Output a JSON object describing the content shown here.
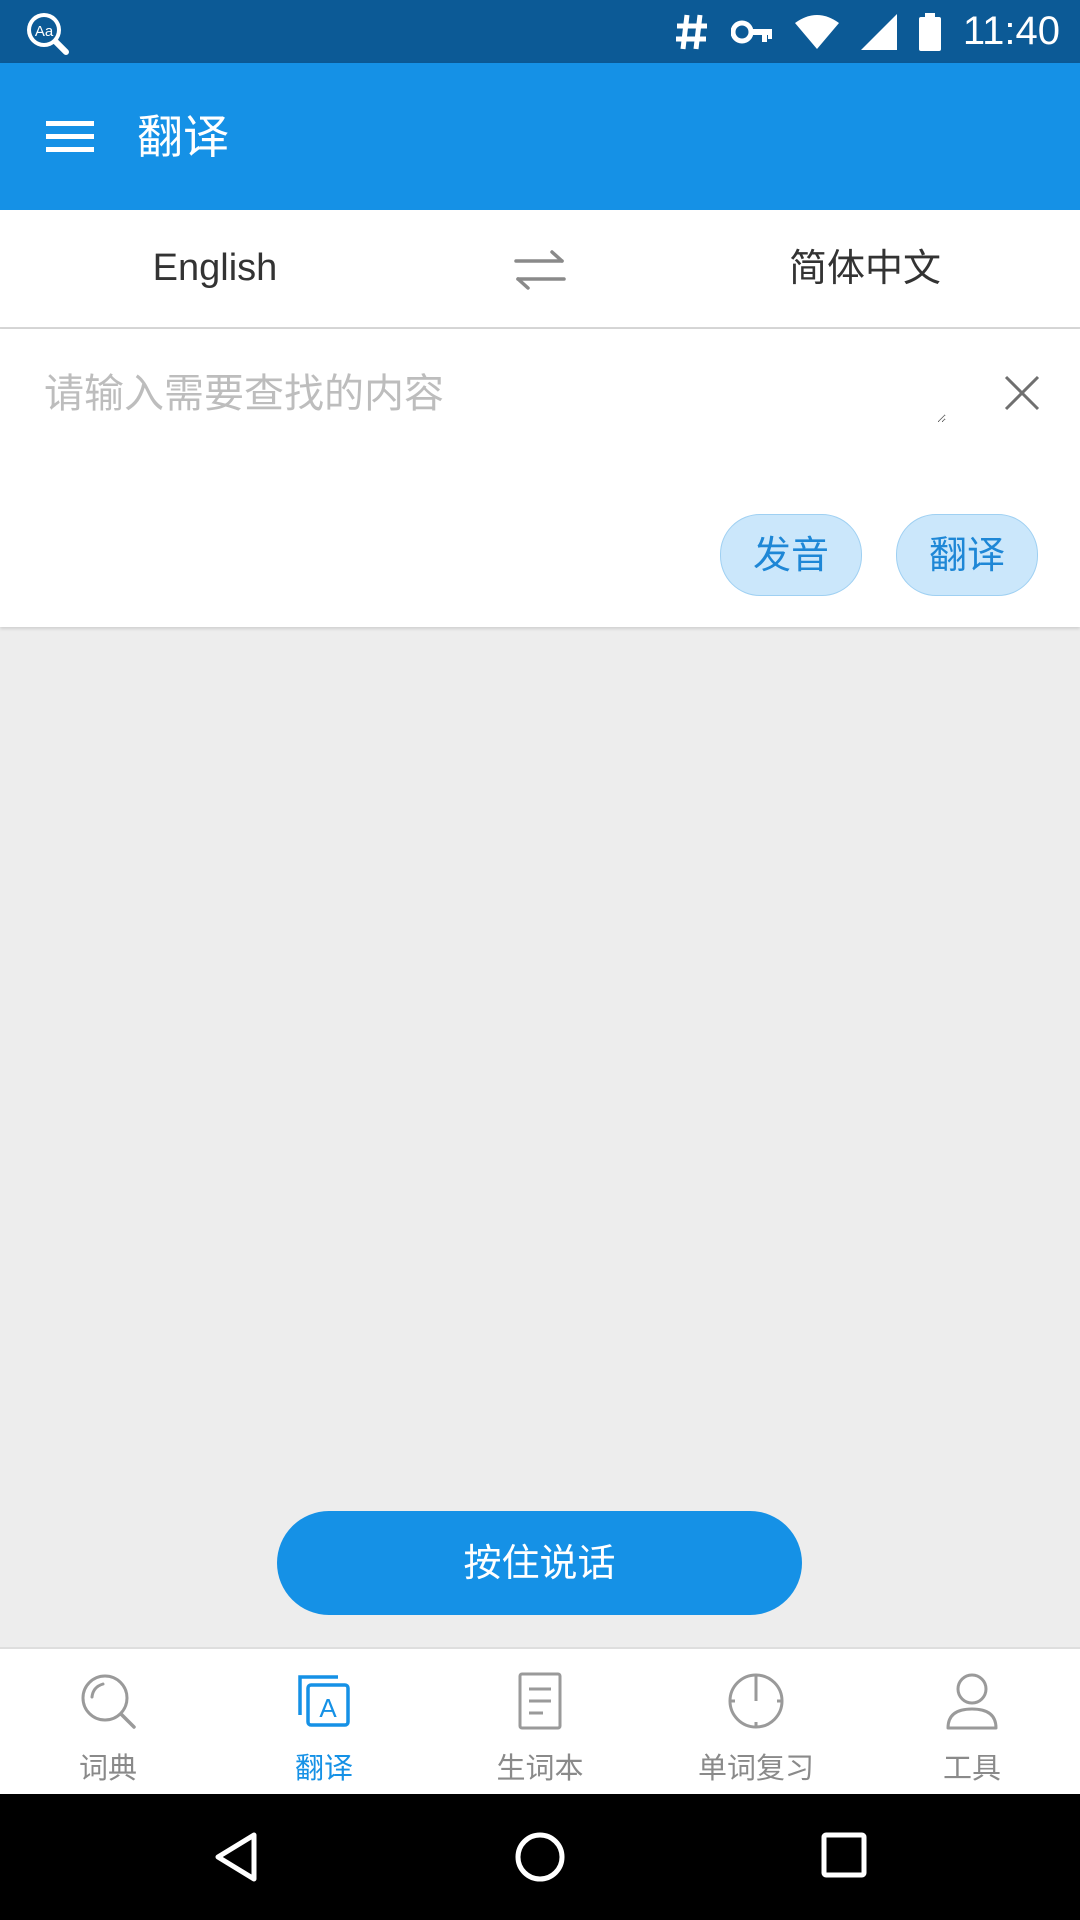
{
  "status_bar": {
    "time": "11:40",
    "app_icon_text": "Aa",
    "icons": [
      "app-search-icon",
      "hash-icon",
      "key-icon",
      "wifi-icon",
      "signal-icon",
      "battery-icon"
    ]
  },
  "app_bar": {
    "title": "翻译",
    "menu_icon": "menu-icon"
  },
  "language_bar": {
    "source": "English",
    "target": "简体中文",
    "swap_icon": "swap-arrows-icon"
  },
  "input": {
    "placeholder": "请输入需要查找的内容",
    "value": ""
  },
  "actions": {
    "speak_label": "发音",
    "translate_label": "翻译"
  },
  "voice": {
    "hold_to_talk_label": "按住说话"
  },
  "tabs": [
    {
      "label": "词典",
      "icon": "search-icon",
      "active": false
    },
    {
      "label": "翻译",
      "icon": "translate-icon",
      "active": true
    },
    {
      "label": "生词本",
      "icon": "notebook-icon",
      "active": false
    },
    {
      "label": "单词复习",
      "icon": "clock-icon",
      "active": false
    },
    {
      "label": "工具",
      "icon": "person-icon",
      "active": false
    }
  ],
  "colors": {
    "status_bar": "#0c5a96",
    "primary": "#1591e6",
    "pill_bg": "#cbe7fb",
    "content_bg": "#ededed"
  }
}
